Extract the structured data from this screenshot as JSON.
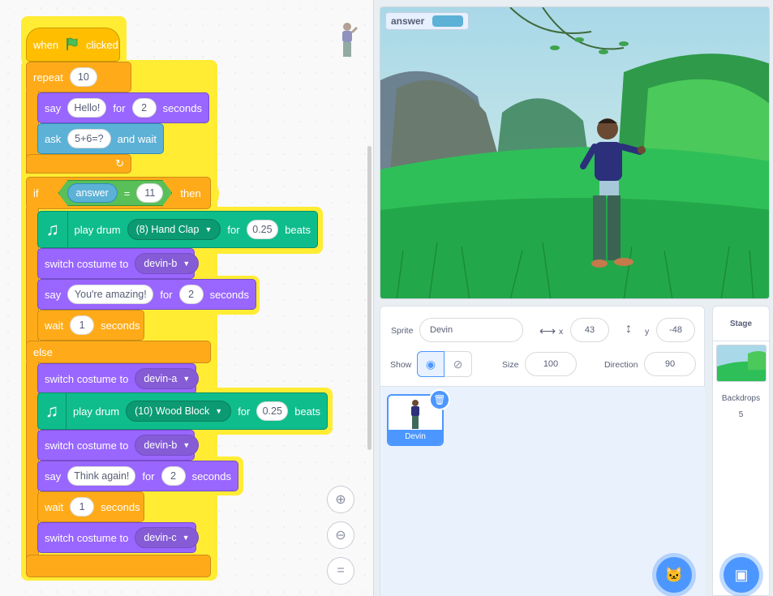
{
  "code": {
    "hat": {
      "when": "when",
      "clicked": "clicked"
    },
    "repeat": {
      "label": "repeat",
      "count": "10"
    },
    "say1": {
      "say": "say",
      "text": "Hello!",
      "for": "for",
      "secs": "2",
      "seconds": "seconds"
    },
    "ask": {
      "ask": "ask",
      "text": "5+6=?",
      "wait": "and wait"
    },
    "ifblk": {
      "if": "if",
      "answer": "answer",
      "eq": "=",
      "value": "11",
      "then": "then",
      "else": "else"
    },
    "drum1": {
      "play": "play drum",
      "drum": "(8) Hand Clap",
      "for": "for",
      "beats_val": "0.25",
      "beats": "beats"
    },
    "costume1": {
      "label": "switch costume to",
      "value": "devin-b"
    },
    "say2": {
      "say": "say",
      "text": "You're amazing!",
      "for": "for",
      "secs": "2",
      "seconds": "seconds"
    },
    "wait1": {
      "wait": "wait",
      "secs": "1",
      "seconds": "seconds"
    },
    "costume2": {
      "label": "switch costume to",
      "value": "devin-a"
    },
    "drum2": {
      "play": "play drum",
      "drum": "(10) Wood Block",
      "for": "for",
      "beats_val": "0.25",
      "beats": "beats"
    },
    "costume3": {
      "label": "switch costume to",
      "value": "devin-b"
    },
    "say3": {
      "say": "say",
      "text": "Think again!",
      "for": "for",
      "secs": "2",
      "seconds": "seconds"
    },
    "wait2": {
      "wait": "wait",
      "secs": "1",
      "seconds": "seconds"
    },
    "costume4": {
      "label": "switch costume to",
      "value": "devin-c"
    }
  },
  "zoom": {
    "in_icon": "zoom-in-icon",
    "out_icon": "zoom-out-icon",
    "reset_icon": "zoom-reset-icon"
  },
  "stage": {
    "monitor_label": "answer",
    "monitor_value": ""
  },
  "sprite_info": {
    "sprite_label": "Sprite",
    "sprite_name": "Devin",
    "x_label": "x",
    "x_value": "43",
    "y_label": "y",
    "y_value": "-48",
    "show_label": "Show",
    "size_label": "Size",
    "size_value": "100",
    "direction_label": "Direction",
    "direction_value": "90"
  },
  "sprite_list": {
    "items": [
      {
        "name": "Devin"
      }
    ]
  },
  "stage_panel": {
    "title": "Stage",
    "backdrops_label": "Backdrops",
    "backdrops_count": "5"
  },
  "colors": {
    "events": "#ffbf00",
    "control": "#ffab19",
    "looks": "#9966ff",
    "sensing": "#5cb1d6",
    "operators": "#59c059",
    "music": "#0fbd8c",
    "accent": "#4c97ff"
  }
}
